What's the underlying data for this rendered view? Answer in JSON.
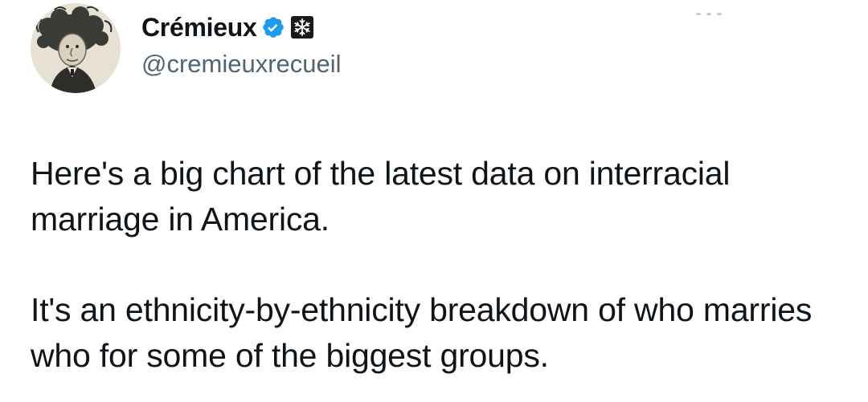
{
  "author": {
    "display_name": "Crémieux",
    "handle": "@cremieuxrecueil",
    "verified": true,
    "verified_color": "#1d9bf0",
    "affiliate_icon": "snowflake-badge-icon",
    "avatar": "portrait-caricature-avatar"
  },
  "tweet": {
    "paragraph_1": "Here's a big chart of the latest data on interracial marriage in America.",
    "paragraph_2": "It's an ethnicity-by-ethnicity breakdown of who marries who for some of the biggest groups."
  },
  "colors": {
    "text_primary": "#0f1419",
    "text_secondary": "#536471",
    "badge_blue": "#1d9bf0"
  }
}
